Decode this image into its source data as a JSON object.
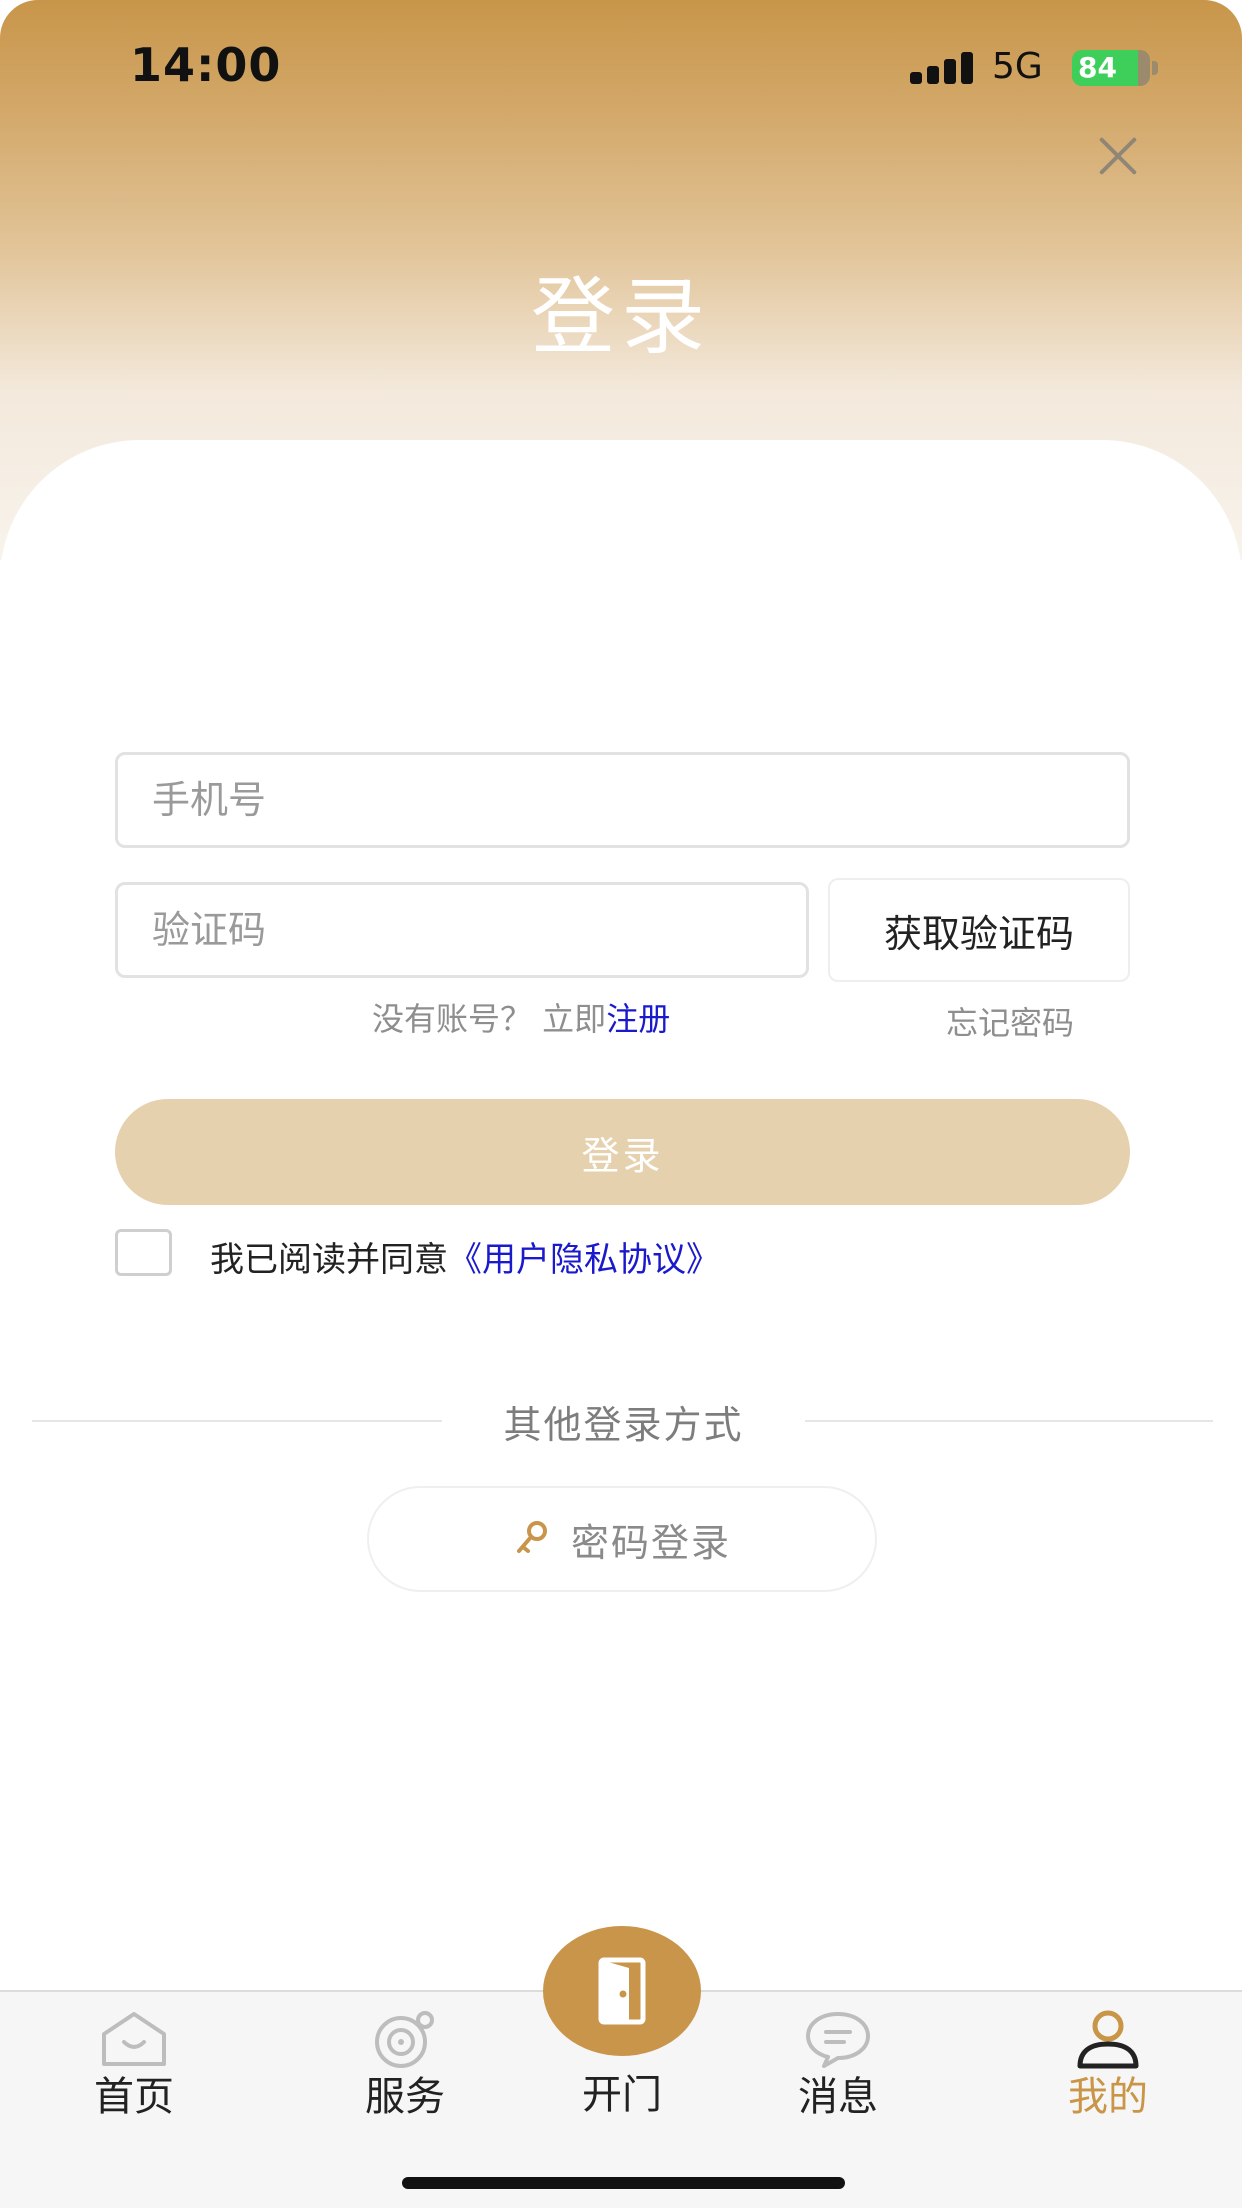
{
  "status_bar": {
    "time": "14:00",
    "network": "5G",
    "battery": "84",
    "battery_level": 0.84
  },
  "header": {
    "title": "登录",
    "close_icon": "close-icon"
  },
  "form": {
    "phone_placeholder": "手机号",
    "phone_value": "",
    "code_placeholder": "验证码",
    "code_value": "",
    "get_code_label": "获取验证码",
    "no_account_text": "没有账号？ 立即",
    "register_label": "注册",
    "forgot_password_label": "忘记密码",
    "login_label": "登录",
    "agree_checked": false,
    "agree_text": "我已阅读并同意",
    "agreement_link": "《用户隐私协议》"
  },
  "other_login": {
    "label": "其他登录方式",
    "password_login_label": "密码登录",
    "password_login_icon": "key-icon"
  },
  "tab_bar": {
    "items": [
      {
        "label": "首页",
        "icon": "home-icon"
      },
      {
        "label": "服务",
        "icon": "service-icon"
      },
      {
        "label": "开门",
        "icon": "door-icon"
      },
      {
        "label": "消息",
        "icon": "message-icon"
      },
      {
        "label": "我的",
        "icon": "user-icon",
        "active": true
      }
    ]
  },
  "colors": {
    "brand_gold": "#c8954a",
    "login_button": "#e5d1ad",
    "link_blue": "#1a1acc",
    "active_tab": "#c99547"
  }
}
